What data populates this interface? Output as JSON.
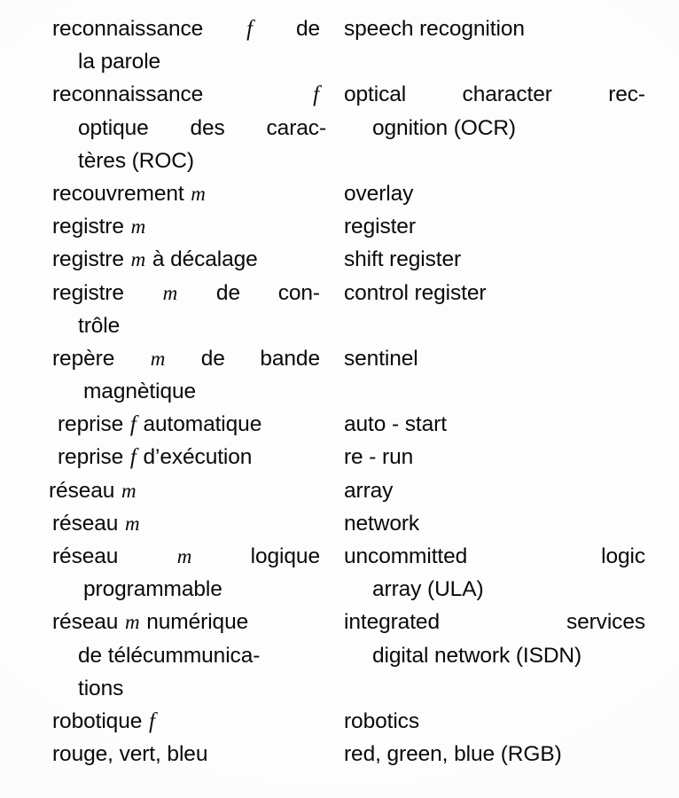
{
  "page": {
    "kind": "scanned-dictionary-page",
    "language_pair": "French – English",
    "background_color": "#fdfdfd",
    "text_color": "#0a0a0a"
  },
  "entries": [
    {
      "id": "speech-recognition",
      "french_lines": [
        [
          {
            "t": "reconnaissance"
          },
          {
            "t": "f",
            "style": "gender-f"
          },
          {
            "t": "de"
          }
        ],
        [
          {
            "t": "la parole"
          }
        ]
      ],
      "english_lines": [
        "speech recognition"
      ]
    },
    {
      "id": "optical-character-recognition",
      "french_lines": [
        [
          {
            "t": "reconnaissance"
          },
          {
            "t": "f",
            "style": "gender-f"
          }
        ],
        [
          {
            "t": "optique"
          },
          {
            "t": "des"
          },
          {
            "t": "carac-"
          }
        ],
        [
          {
            "t": "tères (ROC)"
          }
        ]
      ],
      "english_lines": [
        "optical character rec-",
        "ognition (OCR)"
      ]
    },
    {
      "id": "overlay",
      "french_lines": [
        [
          {
            "t": "recouvrement"
          },
          {
            "t": "m",
            "style": "gender-m"
          }
        ]
      ],
      "english_lines": [
        "overlay"
      ]
    },
    {
      "id": "register",
      "french_lines": [
        [
          {
            "t": "registre"
          },
          {
            "t": "m",
            "style": "gender-m"
          }
        ]
      ],
      "english_lines": [
        "register"
      ]
    },
    {
      "id": "shift-register",
      "french_lines": [
        [
          {
            "t": "registre"
          },
          {
            "t": "m",
            "style": "gender-m"
          },
          {
            "t": "à décalage"
          }
        ]
      ],
      "english_lines": [
        "shift register"
      ]
    },
    {
      "id": "control-register",
      "french_lines": [
        [
          {
            "t": "registre"
          },
          {
            "t": "m",
            "style": "gender-m"
          },
          {
            "t": "de"
          },
          {
            "t": "con-"
          }
        ],
        [
          {
            "t": "trôle"
          }
        ]
      ],
      "english_lines": [
        "control register"
      ]
    },
    {
      "id": "sentinel",
      "french_lines": [
        [
          {
            "t": "repère"
          },
          {
            "t": "m",
            "style": "gender-m"
          },
          {
            "t": "de"
          },
          {
            "t": "bande"
          }
        ],
        [
          {
            "t": "magnètique"
          }
        ]
      ],
      "english_lines": [
        "sentinel"
      ]
    },
    {
      "id": "auto-start",
      "french_lines": [
        [
          {
            "t": "reprise"
          },
          {
            "t": "f",
            "style": "gender-f"
          },
          {
            "t": "automatique"
          }
        ]
      ],
      "english_lines": [
        "auto - start"
      ]
    },
    {
      "id": "re-run",
      "french_lines": [
        [
          {
            "t": "reprise"
          },
          {
            "t": "f",
            "style": "gender-f"
          },
          {
            "t": "d’exécution"
          }
        ]
      ],
      "english_lines": [
        "re - run"
      ]
    },
    {
      "id": "array",
      "french_lines": [
        [
          {
            "t": "réseau"
          },
          {
            "t": "m",
            "style": "gender-m"
          }
        ]
      ],
      "english_lines": [
        "array"
      ]
    },
    {
      "id": "network",
      "french_lines": [
        [
          {
            "t": "réseau"
          },
          {
            "t": "m",
            "style": "gender-m"
          }
        ]
      ],
      "english_lines": [
        "network"
      ]
    },
    {
      "id": "uncommitted-logic-array",
      "french_lines": [
        [
          {
            "t": "réseau"
          },
          {
            "t": "m",
            "style": "gender-m"
          },
          {
            "t": "logique"
          }
        ],
        [
          {
            "t": "programmable"
          }
        ]
      ],
      "english_lines": [
        "uncommitted logic",
        "array (ULA)"
      ]
    },
    {
      "id": "isdn",
      "french_lines": [
        [
          {
            "t": "réseau"
          },
          {
            "t": "m",
            "style": "gender-m"
          },
          {
            "t": "numérique"
          }
        ],
        [
          {
            "t": "de télécummunica-"
          }
        ],
        [
          {
            "t": "tions"
          }
        ]
      ],
      "english_lines": [
        "integrated services",
        "digital network (ISDN)"
      ]
    },
    {
      "id": "robotics",
      "french_lines": [
        [
          {
            "t": "robotique"
          },
          {
            "t": "f",
            "style": "gender-f"
          }
        ]
      ],
      "english_lines": [
        "robotics"
      ]
    },
    {
      "id": "rgb",
      "french_lines": [
        [
          {
            "t": "rouge, vert, bleu"
          }
        ]
      ],
      "english_lines": [
        "red, green, blue (RGB)"
      ]
    }
  ],
  "lines": [
    {
      "fr_html": "reconnaissance <i>f</i> de",
      "fr_class": "fr justified",
      "en": "speech recognition",
      "en_class": "en"
    },
    {
      "fr_html": "la parole",
      "fr_class": "fr indent1",
      "en": "",
      "en_class": "en"
    },
    {
      "fr_html": "reconnaissance <i>f</i>",
      "fr_class": "fr justified",
      "en": "optical character rec-",
      "en_class": "en justified"
    },
    {
      "fr_html": "optique des carac-",
      "fr_class": "fr indent1 justified",
      "en": "ognition (OCR)",
      "en_class": "en indent1"
    },
    {
      "fr_html": "tères (ROC)",
      "fr_class": "fr indent1",
      "en": "",
      "en_class": "en"
    },
    {
      "fr_html": "recouvrement <i>m</i>",
      "fr_class": "fr",
      "en": "overlay",
      "en_class": "en"
    },
    {
      "fr_html": "registre <i>m</i>",
      "fr_class": "fr",
      "en": "register",
      "en_class": "en"
    },
    {
      "fr_html": "registre <i>m</i> à décalage",
      "fr_class": "fr",
      "en": "shift register",
      "en_class": "en"
    },
    {
      "fr_html": "registre <i>m</i> de con-",
      "fr_class": "fr justified",
      "en": "control register",
      "en_class": "en"
    },
    {
      "fr_html": "trôle",
      "fr_class": "fr indent1",
      "en": "",
      "en_class": "en"
    },
    {
      "fr_html": "repère <i>m</i> de bande",
      "fr_class": "fr justified",
      "en": "sentinel",
      "en_class": "en"
    },
    {
      "fr_html": "magnètique",
      "fr_class": "fr indent2",
      "en": "",
      "en_class": "en"
    },
    {
      "fr_html": "reprise <i>f</i> automatique",
      "fr_class": "fr nudge",
      "en": "auto - start",
      "en_class": "en"
    },
    {
      "fr_html": "reprise <i>f</i> d’exécution",
      "fr_class": "fr nudge",
      "en": "re - run",
      "en_class": "en"
    },
    {
      "fr_html": "réseau <i>m</i>",
      "fr_class": "fr nudge-l",
      "en": "array",
      "en_class": "en"
    },
    {
      "fr_html": "réseau <i>m</i>",
      "fr_class": "fr",
      "en": "network",
      "en_class": "en"
    },
    {
      "fr_html": "réseau <i>m</i> logique",
      "fr_class": "fr justified",
      "en": "uncommitted logic",
      "en_class": "en justified"
    },
    {
      "fr_html": "programmable",
      "fr_class": "fr indent2",
      "en": "array (ULA)",
      "en_class": "en indent1"
    },
    {
      "fr_html": "réseau <i>m</i> numérique",
      "fr_class": "fr",
      "en": "integrated services",
      "en_class": "en justified"
    },
    {
      "fr_html": "de télécummunica-",
      "fr_class": "fr indent1",
      "en": "digital network (ISDN)",
      "en_class": "en indent1"
    },
    {
      "fr_html": "tions",
      "fr_class": "fr indent1",
      "en": "",
      "en_class": "en"
    },
    {
      "fr_html": "robotique <i>f</i>",
      "fr_class": "fr",
      "en": "robotics",
      "en_class": "en"
    },
    {
      "fr_html": "rouge, vert, bleu",
      "fr_class": "fr",
      "en": "red, green, blue (RGB)",
      "en_class": "en"
    }
  ]
}
